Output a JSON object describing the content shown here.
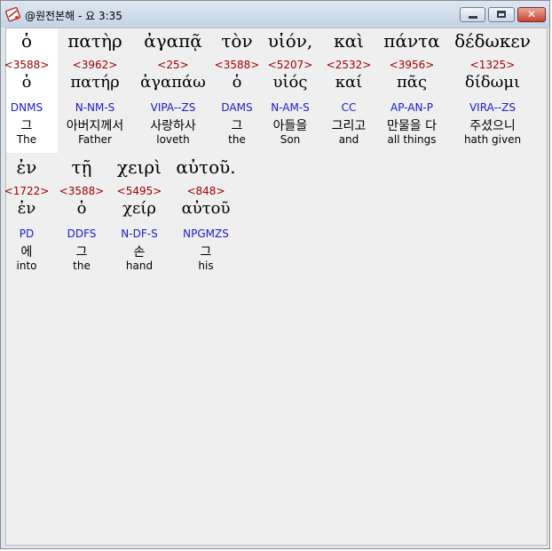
{
  "window": {
    "title": "@원전본해 - 요 3:35",
    "close_glyph": "✕"
  },
  "rows": [
    {
      "words": [
        {
          "greek": "ὁ",
          "strong": "<3588>",
          "lemma": "ὁ",
          "parse": "DNMS",
          "korean": "그",
          "english": "The"
        },
        {
          "greek": "πατὴρ",
          "strong": "<3962>",
          "lemma": "πατήρ",
          "parse": "N-NM-S",
          "korean": "아버지께서",
          "english": "Father"
        },
        {
          "greek": "ἀγαπᾷ",
          "strong": "<25>",
          "lemma": "ἀγαπάω",
          "parse": "VIPA--ZS",
          "korean": "사랑하사",
          "english": "loveth"
        },
        {
          "greek": "τὸν",
          "strong": "<3588>",
          "lemma": "ὁ",
          "parse": "DAMS",
          "korean": "그",
          "english": "the"
        },
        {
          "greek": "υἱόν,",
          "strong": "<5207>",
          "lemma": "υἱός",
          "parse": "N-AM-S",
          "korean": "아들을",
          "english": "Son"
        },
        {
          "greek": "καὶ",
          "strong": "<2532>",
          "lemma": "καί",
          "parse": "CC",
          "korean": "그리고",
          "english": "and"
        },
        {
          "greek": "πάντα",
          "strong": "<3956>",
          "lemma": "πᾶς",
          "parse": "AP-AN-P",
          "korean": "만물을 다",
          "english": "all things"
        },
        {
          "greek": "δέδωκεν",
          "strong": "<1325>",
          "lemma": "δίδωμι",
          "parse": "VIRA--ZS",
          "korean": "주셨으니",
          "english": "hath given"
        }
      ]
    },
    {
      "words": [
        {
          "greek": "ἐν",
          "strong": "<1722>",
          "lemma": "ἐν",
          "parse": "PD",
          "korean": "에",
          "english": "into"
        },
        {
          "greek": "τῇ",
          "strong": "<3588>",
          "lemma": "ὁ",
          "parse": "DDFS",
          "korean": "그",
          "english": "the"
        },
        {
          "greek": "χειρὶ",
          "strong": "<5495>",
          "lemma": "χείρ",
          "parse": "N-DF-S",
          "korean": "손",
          "english": "hand"
        },
        {
          "greek": "αὐτοῦ.",
          "strong": "<848>",
          "lemma": "αὐτοῦ",
          "parse": "NPGMZS",
          "korean": "그",
          "english": "his"
        }
      ]
    }
  ]
}
